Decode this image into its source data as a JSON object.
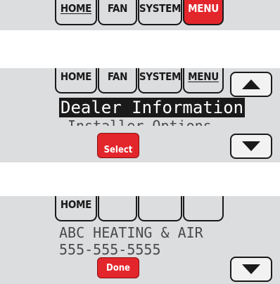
{
  "screen1": {
    "tabs": [
      "HOME",
      "FAN",
      "SYSTEM",
      "MENU"
    ]
  },
  "screen2": {
    "tabs": [
      "HOME",
      "FAN",
      "SYSTEM",
      "MENU"
    ],
    "menu_items": [
      "Dealer Information",
      "Installer Options"
    ],
    "select_label": "Select"
  },
  "screen3": {
    "tabs": [
      "HOME",
      "",
      "",
      ""
    ],
    "dealer_name": "ABC HEATING & AIR",
    "dealer_phone": "555-555-5555",
    "done_label": "Done"
  },
  "icons": {
    "up": "up-arrow-icon",
    "down": "down-arrow-icon"
  },
  "colors": {
    "panel": "#dcdddf",
    "accent_red": "#e3262c",
    "outline": "#1a1a1a"
  }
}
